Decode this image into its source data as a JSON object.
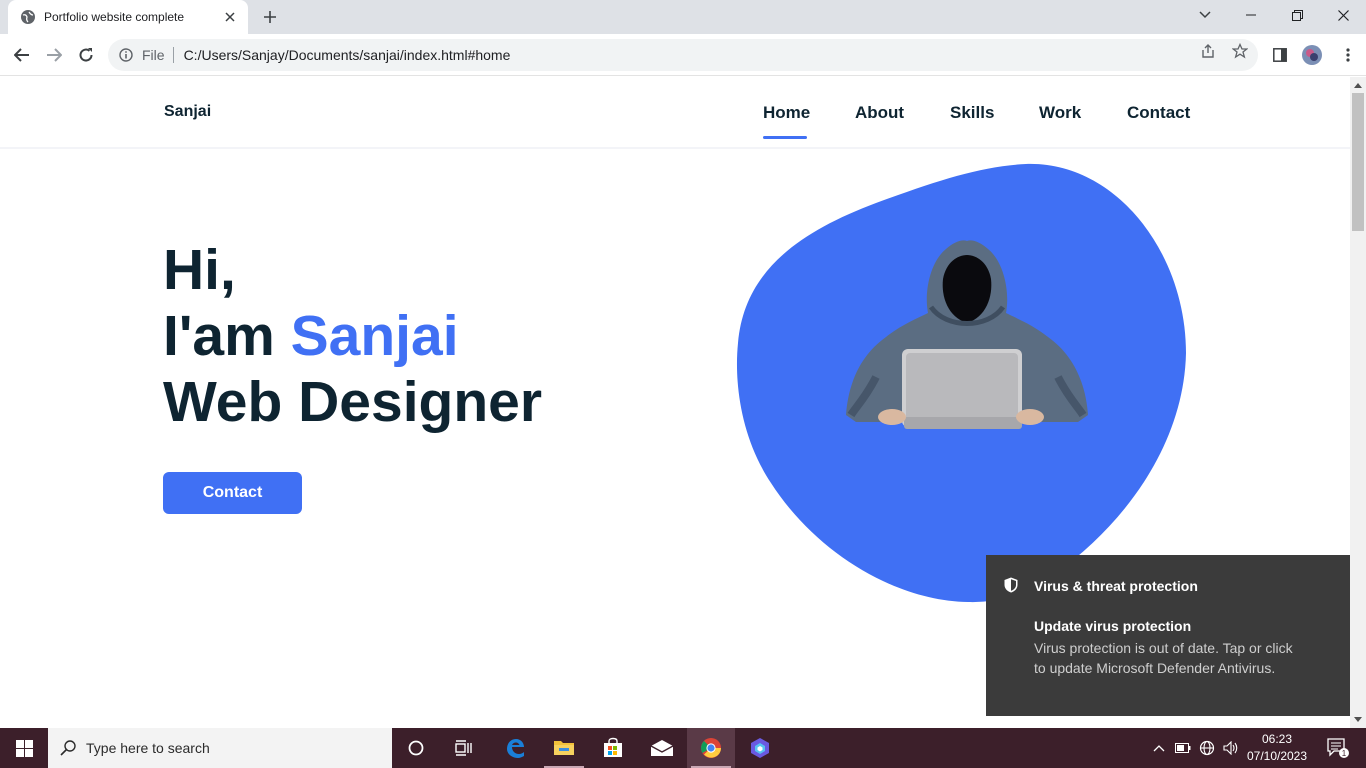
{
  "browser": {
    "tab_title": "Portfolio website complete",
    "scheme_label": "File",
    "url": "C:/Users/Sanjay/Documents/sanjai/index.html#home"
  },
  "site": {
    "logo": "Sanjai",
    "nav": [
      {
        "label": "Home",
        "active": true
      },
      {
        "label": "About",
        "active": false
      },
      {
        "label": "Skills",
        "active": false
      },
      {
        "label": "Work",
        "active": false
      },
      {
        "label": "Contact",
        "active": false
      }
    ],
    "hero": {
      "line1": "Hi,",
      "line2_prefix": "I'am ",
      "name": "Sanjai",
      "line3": "Web Designer",
      "button": "Contact"
    },
    "accent_color": "#4070f4",
    "text_color": "#0e2431"
  },
  "toast": {
    "app": "Virus & threat protection",
    "title": "Update virus protection",
    "body": "Virus protection is out of date. Tap or click to update Microsoft Defender Antivirus."
  },
  "taskbar": {
    "search_placeholder": "Type here to search",
    "time": "06:23",
    "date": "07/10/2023",
    "notification_count": "1",
    "pinned": [
      "cortana-icon",
      "task-view-icon",
      "edge-icon",
      "file-explorer-icon",
      "store-icon",
      "mail-icon",
      "chrome-icon",
      "copilot-icon"
    ]
  }
}
